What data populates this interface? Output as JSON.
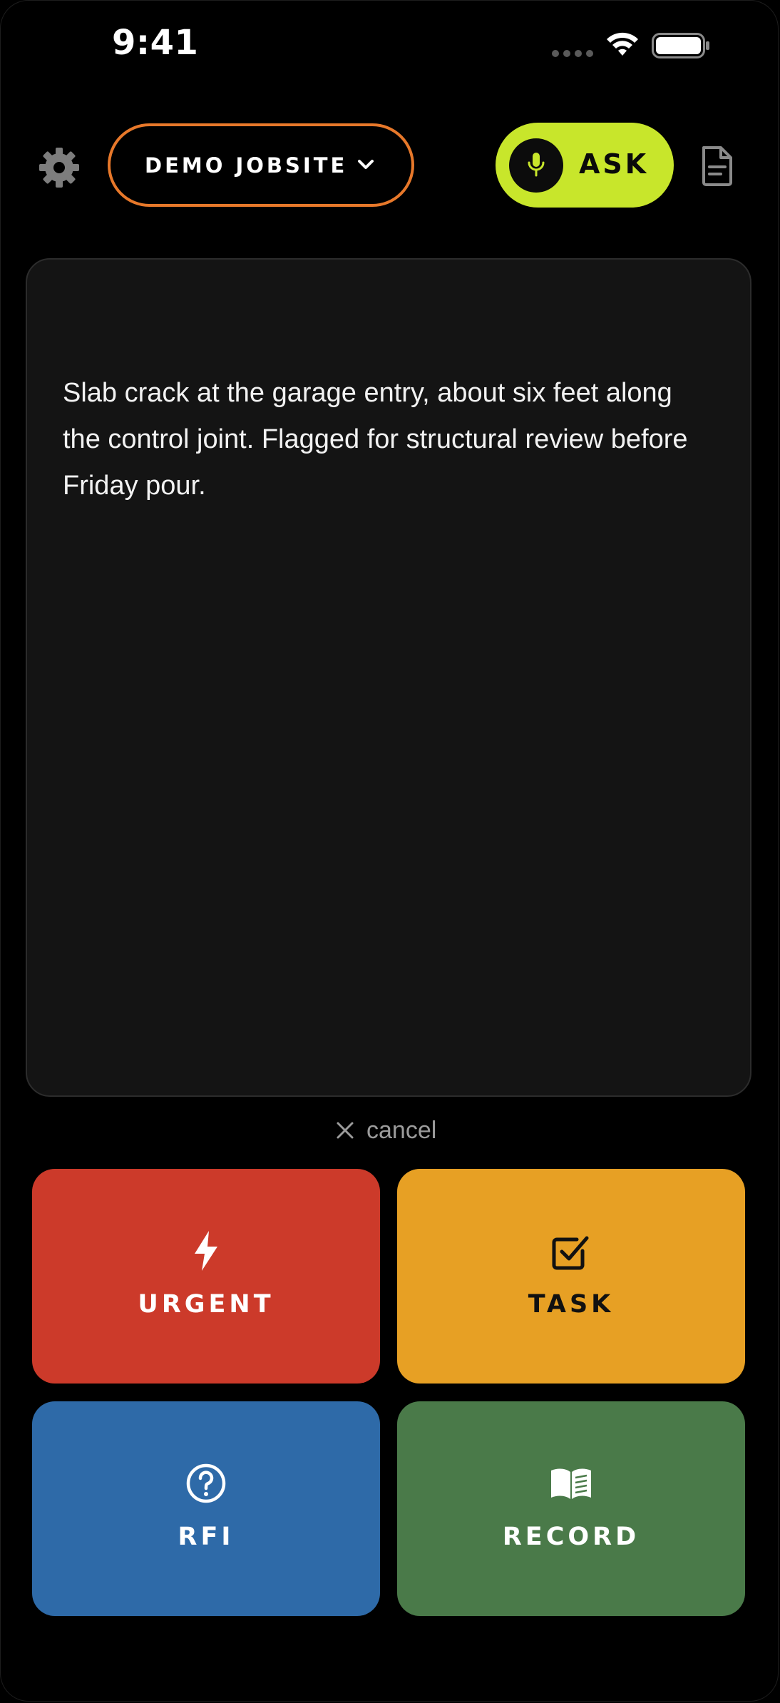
{
  "status_bar": {
    "time": "9:41"
  },
  "header": {
    "jobsite_label": "DEMO JOBSITE",
    "ask_label": "ASK",
    "colors": {
      "jobsite_border": "#e7782a",
      "ask_background": "#c8e62b"
    }
  },
  "transcript": {
    "text": "Slab crack at the garage entry, about six feet along the control joint. Flagged for structural review before Friday pour."
  },
  "cancel": {
    "label": "cancel"
  },
  "actions": [
    {
      "label": "URGENT",
      "icon": "lightning-bolt-icon",
      "color": "#cc3a2a"
    },
    {
      "label": "TASK",
      "icon": "checkbox-icon",
      "color": "#e7a024"
    },
    {
      "label": "RFI",
      "icon": "question-circle-icon",
      "color": "#2e6aa8"
    },
    {
      "label": "RECORD",
      "icon": "open-book-icon",
      "color": "#4a7a49"
    }
  ]
}
